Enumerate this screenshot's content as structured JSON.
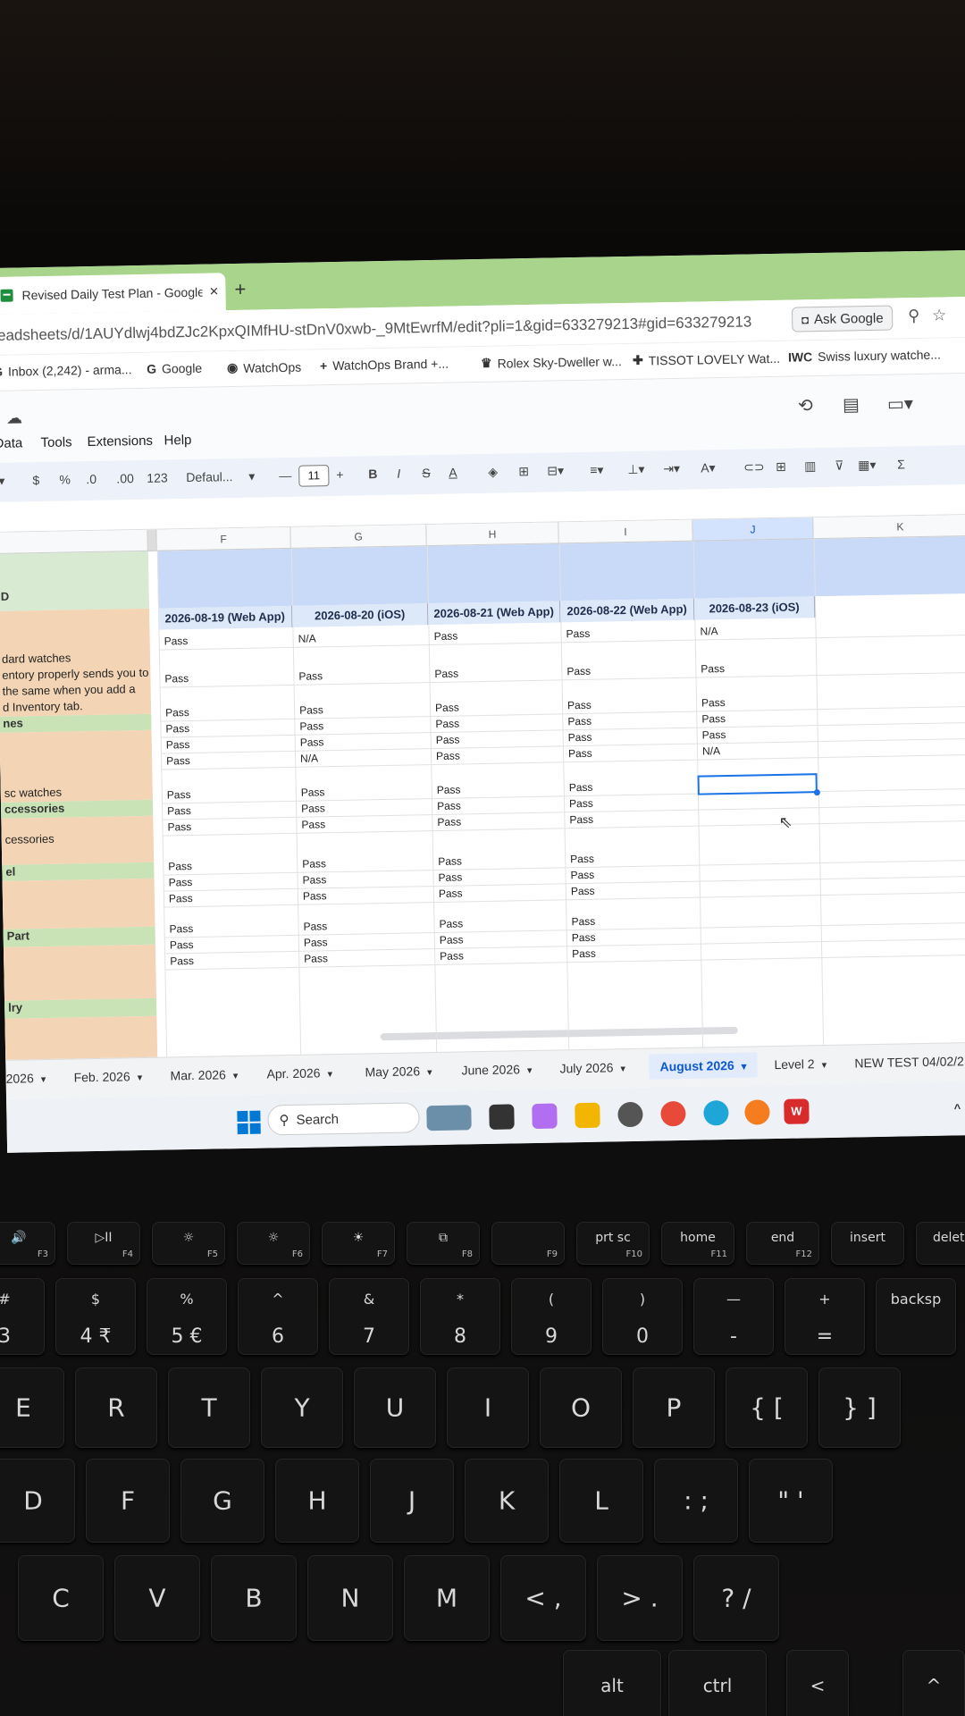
{
  "browser": {
    "tab_title": "Revised Daily Test Plan - Google",
    "tab_close": "×",
    "new_tab": "+",
    "url": "readsheets/d/1AUYdlwj4bdZJc2KpxQIMfHU-stDnV0xwb-_9MtEwrfM/edit?pli=1&gid=633279213#gid=633279213",
    "ask_google": "Ask Google",
    "bookmarks": [
      {
        "icon": "G",
        "label": "Inbox (2,242) - arma..."
      },
      {
        "icon": "G",
        "label": "Google"
      },
      {
        "icon": "◉",
        "label": "WatchOps"
      },
      {
        "icon": "+",
        "label": "WatchOps Brand +..."
      },
      {
        "icon": "♛",
        "label": "Rolex Sky-Dweller w..."
      },
      {
        "icon": "✚",
        "label": "TISSOT LOVELY Wat..."
      },
      {
        "icon": "IWC",
        "label": "Swiss luxury watche..."
      }
    ]
  },
  "menu": [
    "Data",
    "Tools",
    "Extensions",
    "Help"
  ],
  "toolbar": {
    "font": "Defaul...",
    "font_size": "11",
    "items": [
      "$",
      "%",
      ".0",
      ".00",
      "123"
    ]
  },
  "grid": {
    "columns": [
      "F",
      "G",
      "H",
      "I",
      "J",
      "K"
    ],
    "selected_column": "J",
    "left_labels": [
      {
        "text": "D",
        "style": "header"
      },
      {
        "text": "dard watches",
        "style": "plain"
      },
      {
        "text": "entory properly sends you to",
        "style": "plain"
      },
      {
        "text": "the same when you add a",
        "style": "plain"
      },
      {
        "text": "d Inventory tab.",
        "style": "plain"
      },
      {
        "text": "nes",
        "style": "section"
      },
      {
        "text": "sc watches",
        "style": "plain"
      },
      {
        "text": "ccessories",
        "style": "section"
      },
      {
        "text": "cessories",
        "style": "plain"
      },
      {
        "text": "el",
        "style": "section"
      },
      {
        "text": "Part",
        "style": "section"
      },
      {
        "text": "lry",
        "style": "section"
      }
    ],
    "date_headers": [
      "2026-08-19 (Web App)",
      "2026-08-20 (iOS)",
      "2026-08-21 (Web App)",
      "2026-08-22 (Web App)",
      "2026-08-23 (iOS)"
    ],
    "rows": [
      [
        "Pass",
        "N/A",
        "Pass",
        "Pass",
        "N/A"
      ],
      [
        "Pass",
        "Pass",
        "Pass",
        "Pass",
        "Pass"
      ],
      [
        "Pass",
        "Pass",
        "Pass",
        "Pass",
        "Pass"
      ],
      [
        "Pass",
        "Pass",
        "Pass",
        "Pass",
        "Pass"
      ],
      [
        "Pass",
        "Pass",
        "Pass",
        "Pass",
        "Pass"
      ],
      [
        "Pass",
        "N/A",
        "Pass",
        "Pass",
        "N/A"
      ],
      [
        "Pass",
        "Pass",
        "Pass",
        "Pass",
        ""
      ],
      [
        "Pass",
        "Pass",
        "Pass",
        "Pass",
        ""
      ],
      [
        "Pass",
        "Pass",
        "Pass",
        "Pass",
        ""
      ],
      [
        "Pass",
        "Pass",
        "Pass",
        "Pass",
        ""
      ],
      [
        "Pass",
        "Pass",
        "Pass",
        "Pass",
        ""
      ],
      [
        "Pass",
        "Pass",
        "Pass",
        "Pass",
        ""
      ],
      [
        "Pass",
        "Pass",
        "Pass",
        "Pass",
        ""
      ],
      [
        "Pass",
        "Pass",
        "Pass",
        "Pass",
        ""
      ],
      [
        "Pass",
        "Pass",
        "Pass",
        "Pass",
        ""
      ]
    ]
  },
  "sheet_tabs": [
    "2026",
    "Feb. 2026",
    "Mar. 2026",
    "Apr. 2026",
    "May 2026",
    "June 2026",
    "July 2026",
    "August 2026",
    "Level 2",
    "NEW TEST 04/02/2"
  ],
  "active_sheet": "August 2026",
  "taskbar": {
    "search_label": "Search"
  },
  "keyboard": {
    "fn_row": [
      {
        "top": "🔊",
        "f": "F3"
      },
      {
        "top": "▷II",
        "f": "F4"
      },
      {
        "top": "☼",
        "f": "F5"
      },
      {
        "top": "☼",
        "f": "F6"
      },
      {
        "top": "☀",
        "f": "F7"
      },
      {
        "top": "⧉",
        "f": "F8"
      },
      {
        "top": "",
        "f": "F9"
      },
      {
        "top": "prt sc",
        "f": "F10"
      },
      {
        "top": "home",
        "f": "F11"
      },
      {
        "top": "end",
        "f": "F12"
      },
      {
        "top": "insert",
        "f": ""
      },
      {
        "top": "delete",
        "f": ""
      }
    ],
    "num_row": [
      {
        "a": "#",
        "b": "3"
      },
      {
        "a": "$",
        "b": "4 ₹"
      },
      {
        "a": "%",
        "b": "5 €"
      },
      {
        "a": "^",
        "b": "6"
      },
      {
        "a": "&",
        "b": "7"
      },
      {
        "a": "*",
        "b": "8"
      },
      {
        "a": "(",
        "b": "9"
      },
      {
        "a": ")",
        "b": "0"
      },
      {
        "a": "—",
        "b": "-"
      },
      {
        "a": "+",
        "b": "="
      },
      {
        "a": "backsp",
        "b": ""
      }
    ],
    "row_q": [
      "E",
      "R",
      "T",
      "Y",
      "U",
      "I",
      "O",
      "P",
      "{ [",
      "} ]"
    ],
    "row_a": [
      "D",
      "F",
      "G",
      "H",
      "J",
      "K",
      "L",
      ": ;",
      "\" '"
    ],
    "row_z": [
      "C",
      "V",
      "B",
      "N",
      "M",
      "< ,",
      "> .",
      "? /"
    ],
    "bottom": [
      "alt",
      "ctrl",
      "<",
      "^"
    ]
  }
}
